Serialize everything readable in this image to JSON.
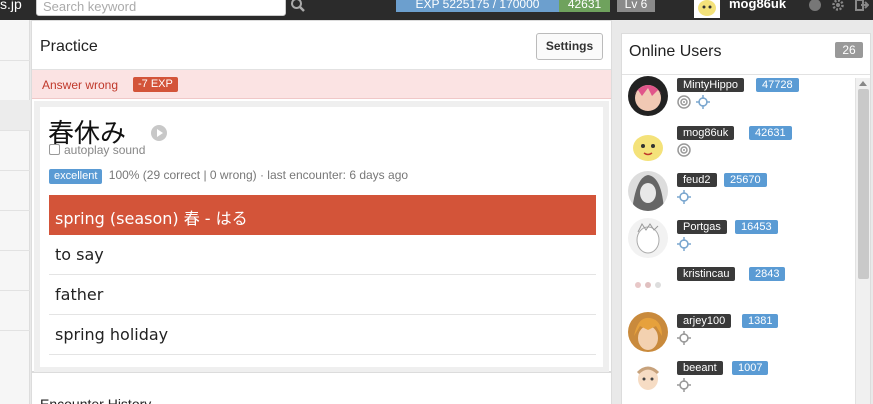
{
  "header": {
    "site_name": "s.jp",
    "search_placeholder": "Search keyword",
    "exp": "EXP 5225175 / 170000",
    "exp_points": "42631",
    "level": "Lv 6",
    "username": "mog86uk",
    "icons": [
      "search-icon",
      "status-dot-icon",
      "gear-icon",
      "logout-icon"
    ]
  },
  "practice": {
    "title": "Practice",
    "settings_label": "Settings",
    "alert_text": "Answer wrong",
    "alert_badge": "-7 EXP",
    "word": "春休み",
    "autoplay_label": "autoplay sound",
    "autoplay_checked": false,
    "rating": "excellent",
    "stats": "100% (29 correct | 0 wrong)  ·  last encounter: 6 days ago",
    "answers": [
      {
        "label": "spring (season)  春 - はる",
        "state": "wrong"
      },
      {
        "label": "to say",
        "state": "normal"
      },
      {
        "label": "father",
        "state": "normal"
      },
      {
        "label": "spring holiday",
        "state": "normal"
      }
    ],
    "wrong_color": "#d35439"
  },
  "history": {
    "title": "Encounter History"
  },
  "online_users": {
    "title": "Online Users",
    "count": "26",
    "users": [
      {
        "name": "MintyHippo",
        "score": "47728",
        "icons": [
          "target-icon",
          "crosshair-icon"
        ]
      },
      {
        "name": "mog86uk",
        "score": "42631",
        "icons": [
          "target-icon"
        ]
      },
      {
        "name": "feud2",
        "score": "25670",
        "icons": [
          "crosshair-icon"
        ]
      },
      {
        "name": "Portgas",
        "score": "16453",
        "icons": [
          "crosshair-icon"
        ]
      },
      {
        "name": "kristincau",
        "score": "2843",
        "icons": []
      },
      {
        "name": "arjey100",
        "score": "1381",
        "icons": [
          "crosshair-icon"
        ]
      },
      {
        "name": "beeant",
        "score": "1007",
        "icons": [
          "crosshair-icon"
        ]
      }
    ]
  }
}
